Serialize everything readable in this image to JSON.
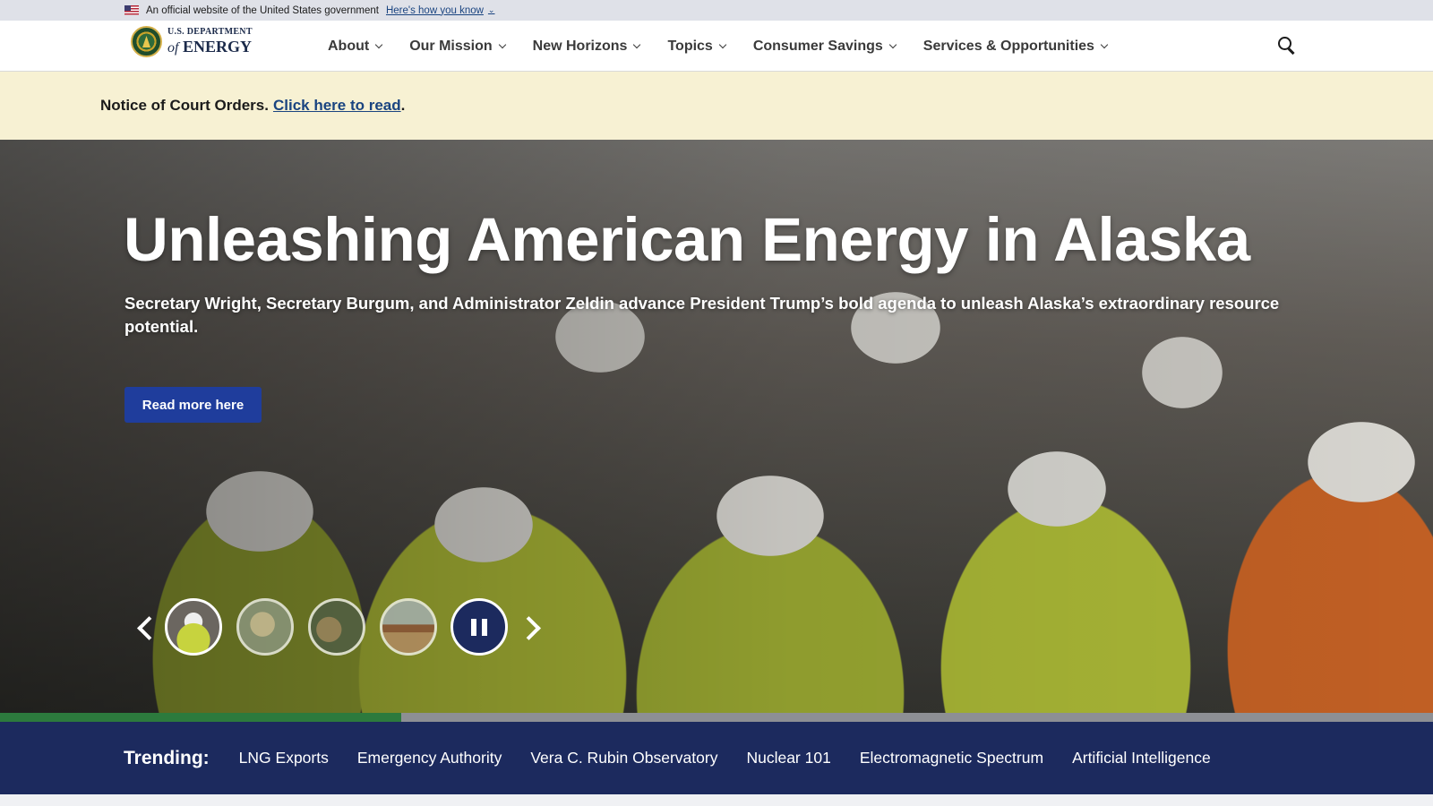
{
  "gov_banner": {
    "text": "An official website of the United States government",
    "link": "Here's how you know"
  },
  "logo": {
    "top": "U.S. DEPARTMENT",
    "of": "of",
    "bottom": "ENERGY"
  },
  "nav": {
    "items": [
      {
        "label": "About"
      },
      {
        "label": "Our Mission"
      },
      {
        "label": "New Horizons"
      },
      {
        "label": "Topics"
      },
      {
        "label": "Consumer Savings"
      },
      {
        "label": "Services & Opportunities"
      }
    ],
    "search_icon": "search-icon"
  },
  "notice": {
    "text": "Notice of Court Orders.",
    "link": "Click here to read",
    "suffix": "."
  },
  "hero": {
    "title": "Unleashing American Energy in Alaska",
    "subtitle": "Secretary Wright, Secretary Burgum, and Administrator Zeldin advance President Trump’s bold agenda to unleash Alaska’s extraordinary resource potential.",
    "button": "Read more here",
    "carousel": {
      "slide_count": 4,
      "active_slide": 1,
      "paused": false,
      "progress": 0.28
    }
  },
  "trending": {
    "label": "Trending:",
    "links": [
      "LNG Exports",
      "Emergency Authority",
      "Vera C. Rubin Observatory",
      "Nuclear 101",
      "Electromagnetic Spectrum",
      "Artificial Intelligence"
    ]
  },
  "colors": {
    "primary_navy": "#1c2a5e",
    "button_blue": "#1f3d9c",
    "notice_bg": "#f7f1d3",
    "progress_green": "#2c7a3d"
  }
}
